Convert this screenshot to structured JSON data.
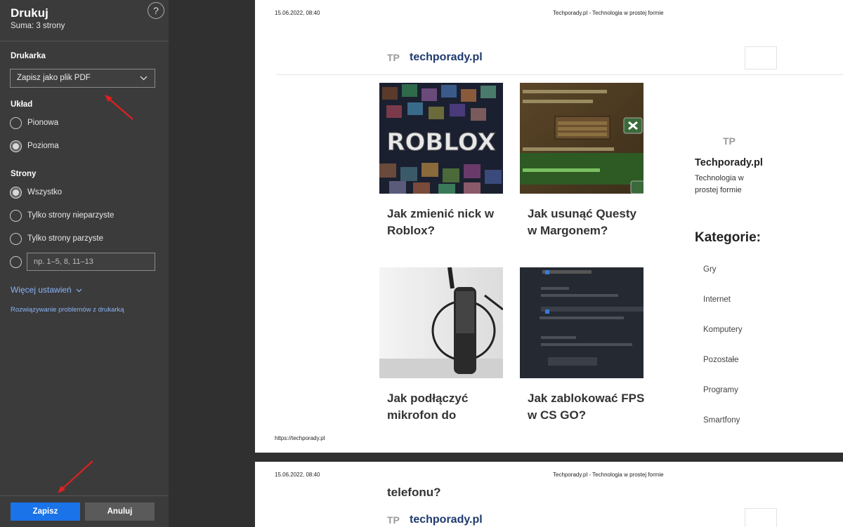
{
  "dialog": {
    "title": "Drukuj",
    "subtitle": "Suma: 3 strony",
    "help_symbol": "?"
  },
  "printer": {
    "label": "Drukarka",
    "selected": "Zapisz jako plik PDF"
  },
  "layout": {
    "label": "Układ",
    "options": [
      {
        "label": "Pionowa",
        "selected": false
      },
      {
        "label": "Pozioma",
        "selected": true
      }
    ]
  },
  "pages": {
    "label": "Strony",
    "options": [
      {
        "label": "Wszystko",
        "selected": true
      },
      {
        "label": "Tylko strony nieparzyste",
        "selected": false
      },
      {
        "label": "Tylko strony parzyste",
        "selected": false
      }
    ],
    "custom_placeholder": "np. 1–5, 8, 11–13"
  },
  "more_settings": "Więcej ustawień",
  "troubleshoot": "Rozwiązywanie problemów z drukarką",
  "buttons": {
    "save": "Zapisz",
    "cancel": "Anuluj"
  },
  "preview": {
    "header_date": "15.06.2022, 08:40",
    "header_site": "Techporady.pl - Technologia w prostej formie",
    "footer_url": "https://techporady.pl",
    "logo_mark": "TP",
    "logo_name": "techporady.pl",
    "posts": [
      {
        "title": "Jak zmienić nick w Roblox?"
      },
      {
        "title": "Jak usunąć Questy w Margonem?"
      },
      {
        "title": "Jak podłączyć mikrofon do"
      },
      {
        "title": "Jak zablokować FPS w CS GO?"
      }
    ],
    "roblox_text": "ROBLOX",
    "sidebar": {
      "logo_mark": "TP",
      "site_name": "Techporady.pl",
      "tagline": "Technologia w prostej formie",
      "categories_heading": "Kategorie:",
      "categories": [
        "Gry",
        "Internet",
        "Komputery",
        "Pozostałe",
        "Programy",
        "Smartfony"
      ]
    },
    "page2_continuation": "telefonu?"
  },
  "colors": {
    "accent": "#1a73e8",
    "link": "#8ab4f8",
    "annotation_arrow": "#e02020"
  }
}
